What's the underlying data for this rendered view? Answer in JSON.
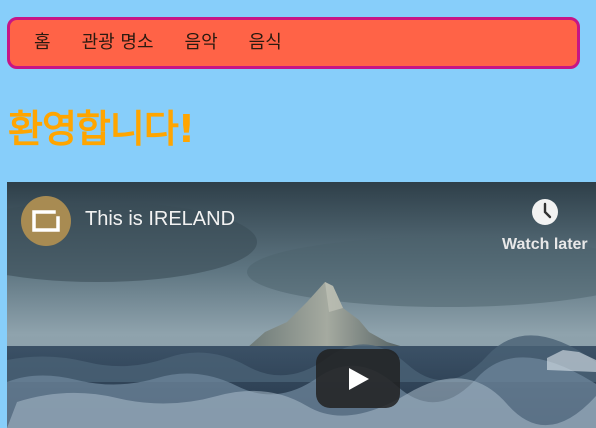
{
  "nav": {
    "items": [
      {
        "label": "홈"
      },
      {
        "label": "관광 명소"
      },
      {
        "label": "음악"
      },
      {
        "label": "음식"
      }
    ]
  },
  "page": {
    "heading": "환영합니다!"
  },
  "video": {
    "title": "This is IRELAND",
    "watch_later_label": "Watch later",
    "icons": {
      "channel": "channel-logo-icon",
      "watch_later": "clock-icon",
      "play": "play-icon"
    }
  },
  "colors": {
    "page_background": "#87cefa",
    "nav_background": "#ff6347",
    "nav_border": "#c71585",
    "heading": "#ffa500"
  }
}
